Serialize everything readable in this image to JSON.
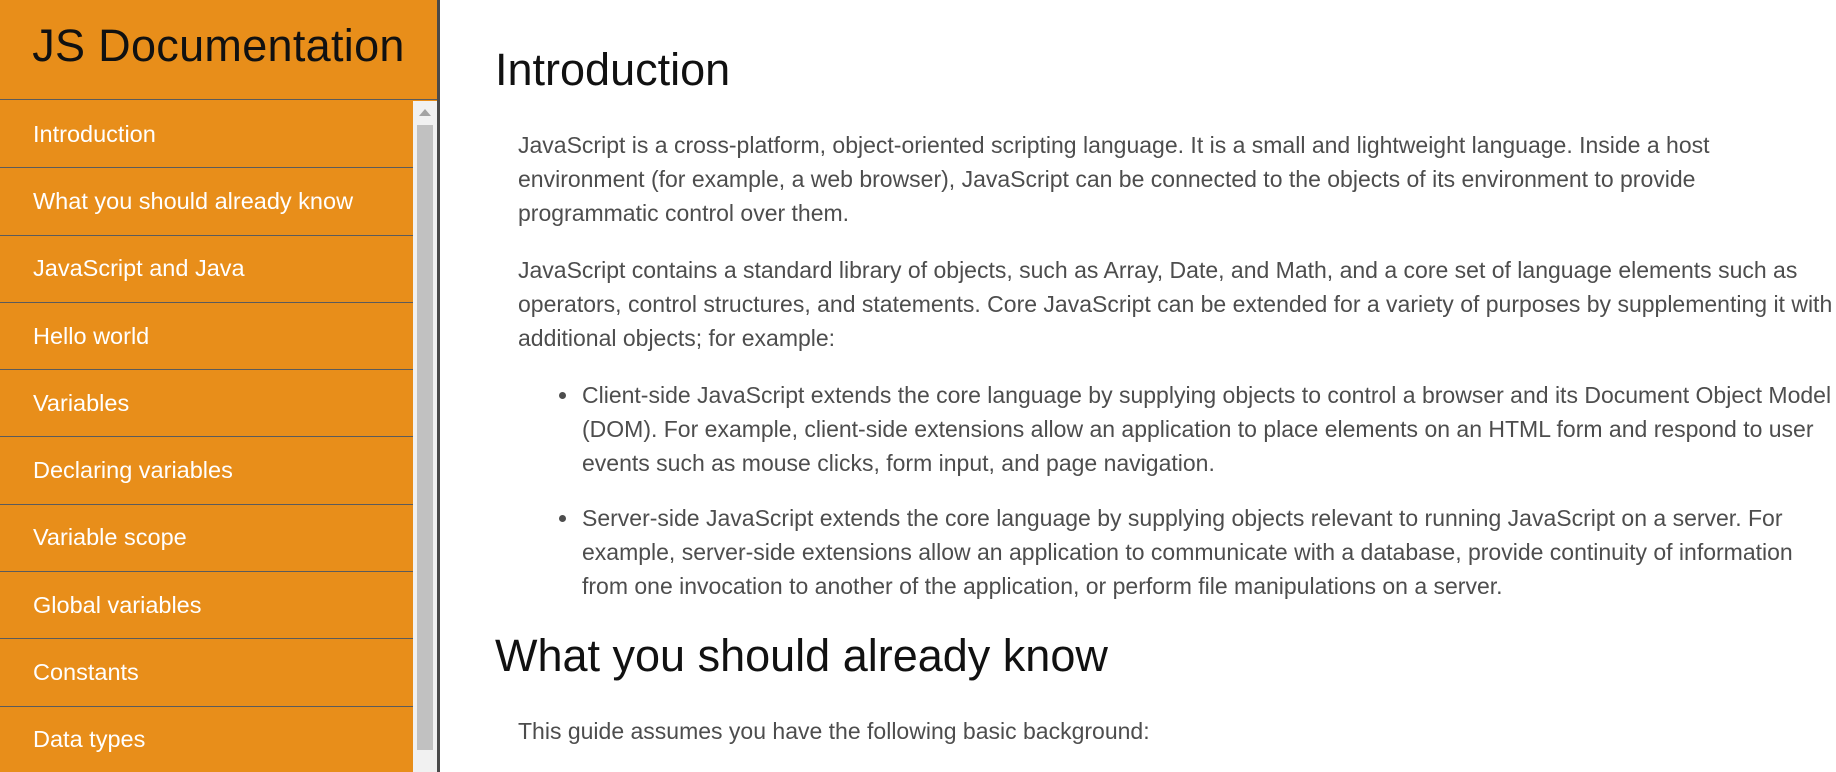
{
  "sidebar": {
    "title": "JS Documentation",
    "items": [
      {
        "label": "Introduction"
      },
      {
        "label": "What you should already know"
      },
      {
        "label": "JavaScript and Java"
      },
      {
        "label": "Hello world"
      },
      {
        "label": "Variables"
      },
      {
        "label": "Declaring variables"
      },
      {
        "label": "Variable scope"
      },
      {
        "label": "Global variables"
      },
      {
        "label": "Constants"
      },
      {
        "label": "Data types"
      }
    ]
  },
  "main": {
    "sections": [
      {
        "title": "Introduction",
        "paragraphs": [
          "JavaScript is a cross-platform, object-oriented scripting language. It is a small and lightweight language. Inside a host environment (for example, a web browser), JavaScript can be connected to the objects of its environment to provide programmatic control over them.",
          "JavaScript contains a standard library of objects, such as Array, Date, and Math, and a core set of language elements such as operators, control structures, and statements. Core JavaScript can be extended for a variety of purposes by supplementing it with additional objects; for example:"
        ],
        "bullets": [
          "Client-side JavaScript extends the core language by supplying objects to control a browser and its Document Object Model (DOM). For example, client-side extensions allow an application to place elements on an HTML form and respond to user events such as mouse clicks, form input, and page navigation.",
          "Server-side JavaScript extends the core language by supplying objects relevant to running JavaScript on a server. For example, server-side extensions allow an application to communicate with a database, provide continuity of information from one invocation to another of the application, or perform file manipulations on a server."
        ]
      },
      {
        "title": "What you should already know",
        "paragraphs": [
          "This guide assumes you have the following basic background:"
        ]
      }
    ]
  },
  "colors": {
    "sidebar_bg": "#e88e1a",
    "nav_text": "#ffffff",
    "body_text": "#4d4d4d",
    "heading_text": "#111111"
  }
}
